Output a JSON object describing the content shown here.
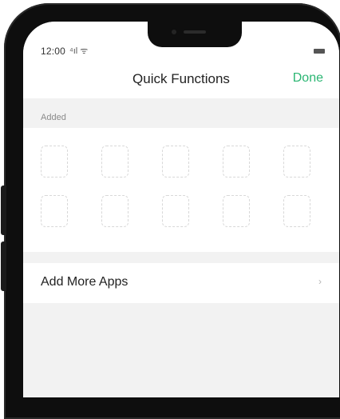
{
  "status_bar": {
    "time": "12:00",
    "signal_text": "⁴ıl ᯤ",
    "icons": [
      "signal-icon",
      "wifi-icon",
      "battery-icon"
    ]
  },
  "header": {
    "title": "Quick Functions",
    "done_label": "Done"
  },
  "added_section": {
    "label": "Added",
    "slot_rows": 2,
    "slot_cols": 5
  },
  "add_more": {
    "label": "Add More Apps",
    "chevron": "›"
  },
  "colors": {
    "accent": "#2bb673",
    "background": "#f2f2f2",
    "panel": "#ffffff"
  }
}
